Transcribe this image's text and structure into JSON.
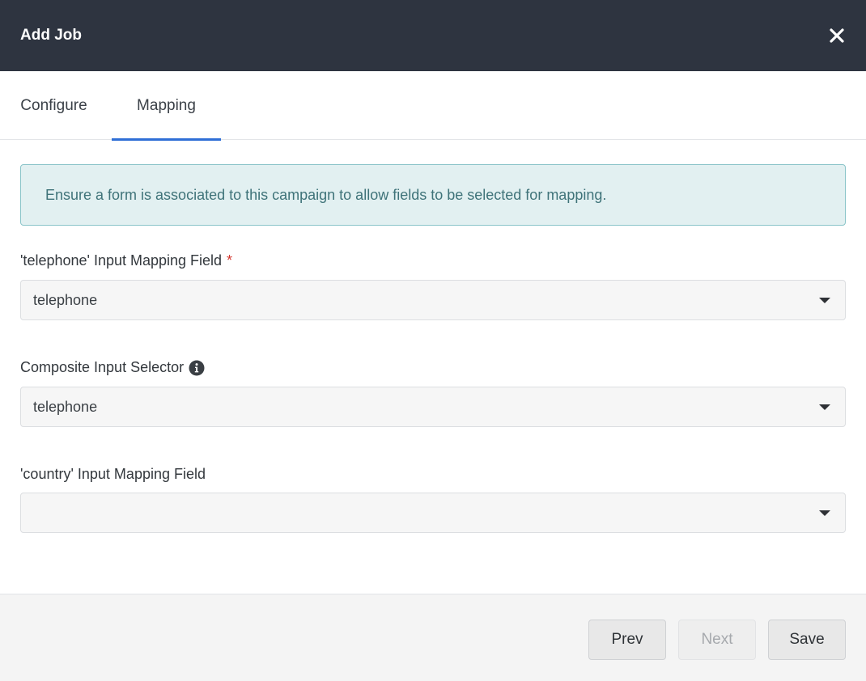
{
  "header": {
    "title": "Add Job",
    "close_icon": "close-icon"
  },
  "tabs": [
    {
      "label": "Configure",
      "active": false
    },
    {
      "label": "Mapping",
      "active": true
    }
  ],
  "alert": {
    "text": "Ensure a form is associated to this campaign to allow fields to be selected for mapping."
  },
  "fields": [
    {
      "label": "'telephone' Input Mapping Field",
      "required": true,
      "value": "telephone"
    },
    {
      "label": "Composite Input Selector",
      "info_icon": "info-icon",
      "value": "telephone"
    },
    {
      "label": "'country' Input Mapping Field",
      "value": ""
    }
  ],
  "required_marker": "*",
  "footer": {
    "prev_label": "Prev",
    "next_label": "Next",
    "save_label": "Save"
  },
  "colors": {
    "header_bg": "#2e3440",
    "tab_active": "#2f6fd6",
    "alert_bg": "#e2f0f1",
    "alert_border": "#8ac4c9",
    "required": "#d4362d"
  }
}
